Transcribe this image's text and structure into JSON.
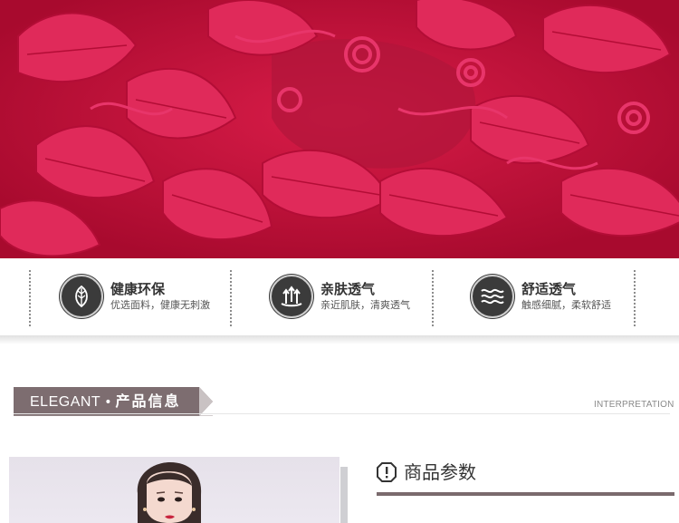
{
  "hero": {
    "image": "red-floral-lace-closeup",
    "colors": {
      "base": "#c0103a",
      "lace": "#e0285a",
      "mesh": "#9e0c30"
    }
  },
  "features": [
    {
      "title": "健康环保",
      "subtitle": "优选面料，健康无刺激",
      "icon": "leaf-icon"
    },
    {
      "title": "亲肤透气",
      "subtitle": "亲近肌肤，清爽透气",
      "icon": "breathable-arrows-icon"
    },
    {
      "title": "舒适透气",
      "subtitle": "触感细腻，柔软舒适",
      "icon": "wave-icon"
    }
  ],
  "section": {
    "en": "ELEGANT",
    "dot": "•",
    "cn": "产品信息",
    "right_label": "INTERPRETATION"
  },
  "product_photo": {
    "image": "model-portrait"
  },
  "params": {
    "icon": "info-icon",
    "title": "商品参数"
  },
  "colors": {
    "banner": "#7d6d70",
    "divider": "#7a6a6d",
    "icon_dark": "#3b3b3b"
  }
}
